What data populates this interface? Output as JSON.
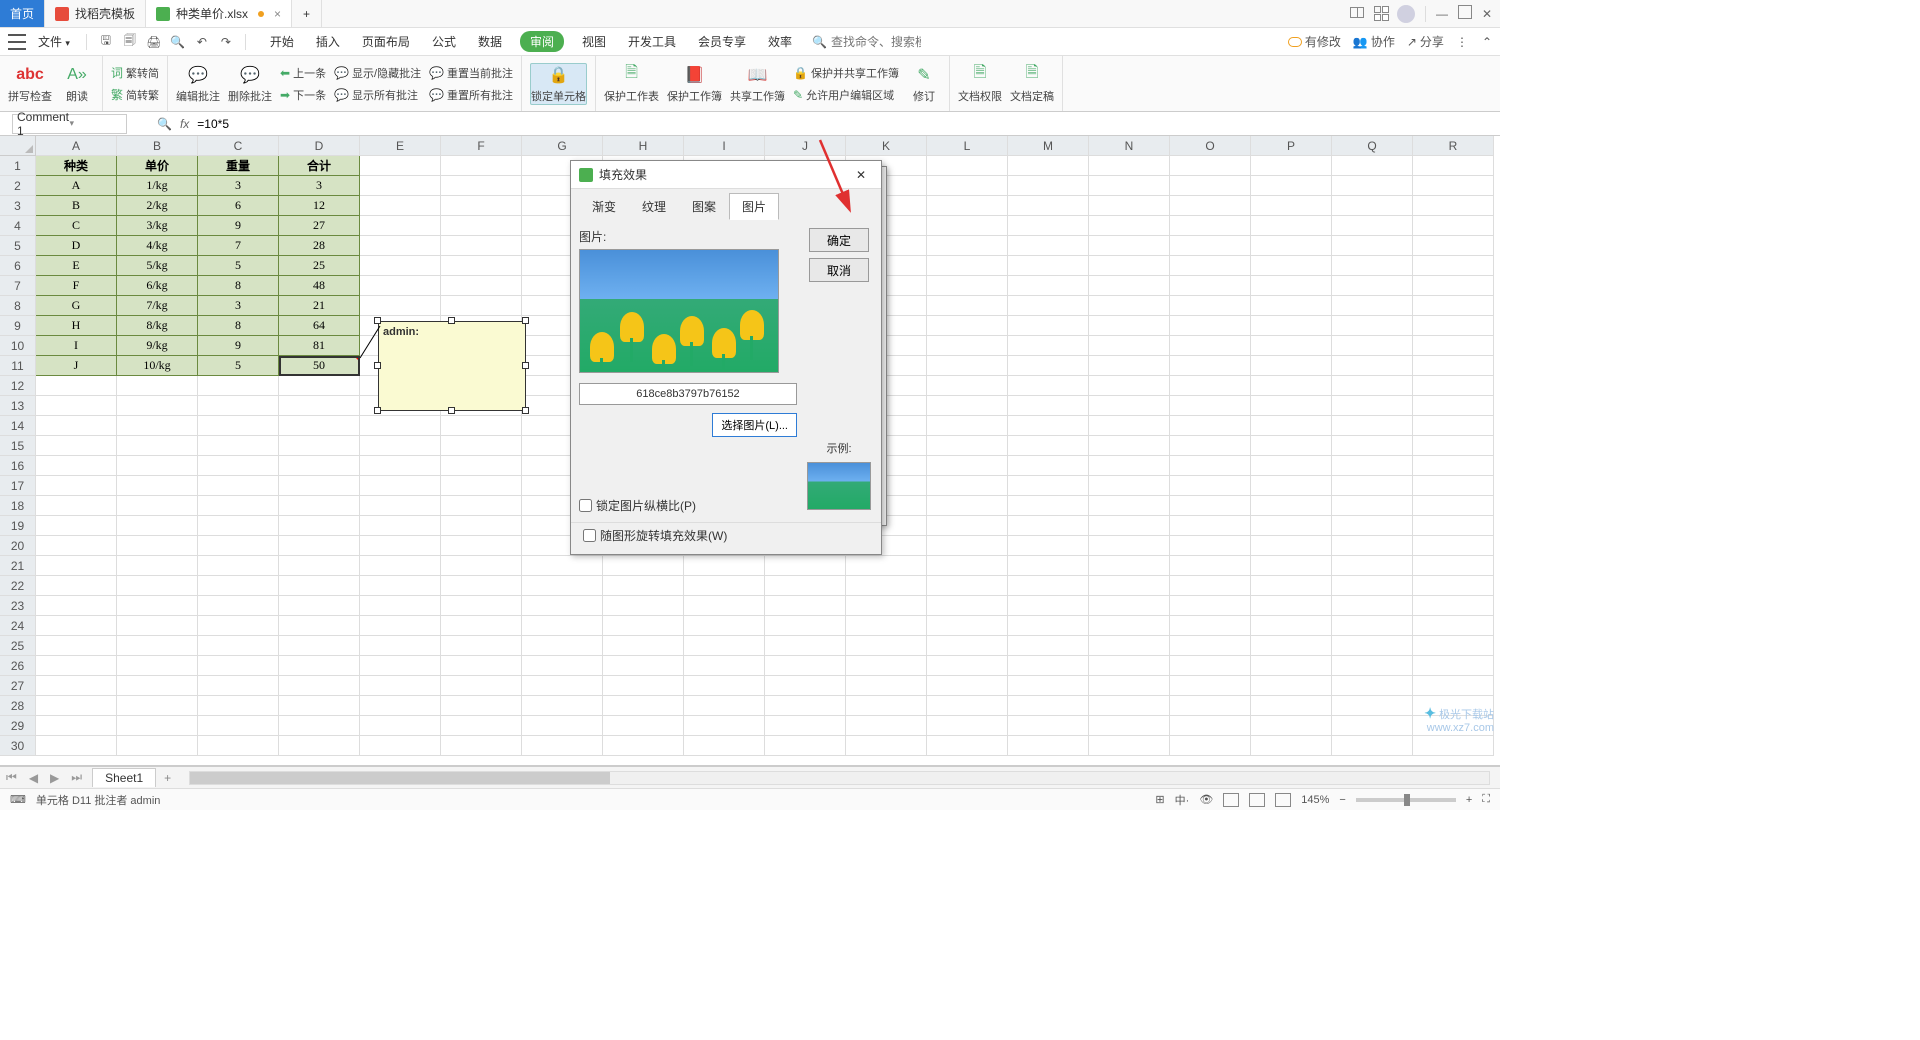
{
  "tabs": {
    "home": "首页",
    "template": "找稻壳模板",
    "file": "种类单价.xlsx"
  },
  "menu": {
    "file": "文件",
    "items": [
      "开始",
      "插入",
      "页面布局",
      "公式",
      "数据",
      "审阅",
      "视图",
      "开发工具",
      "会员专享",
      "效率"
    ],
    "active": "审阅",
    "search_placeholder": "查找命令、搜索模板"
  },
  "ribbon": {
    "g1a": "拼写检查",
    "g1b": "朗读",
    "g2a": "繁转简",
    "g2b": "简转繁",
    "g3a": "编辑批注",
    "g3b": "删除批注",
    "g4a": "上一条",
    "g4b": "下一条",
    "g4c": "显示/隐藏批注",
    "g4d": "显示所有批注",
    "g4e": "重置当前批注",
    "g4f": "重置所有批注",
    "g5": "锁定单元格",
    "g6": "保护工作表",
    "g7": "保护工作簿",
    "g8": "共享工作簿",
    "g9a": "保护并共享工作簿",
    "g9b": "允许用户编辑区域",
    "g10": "修订",
    "g11": "文档权限",
    "g12": "文档定稿"
  },
  "topright": {
    "mod": "有修改",
    "coop": "协作",
    "share": "分享"
  },
  "namebox": "Comment 1",
  "formula": "=10*5",
  "columns": [
    "A",
    "B",
    "C",
    "D",
    "E",
    "F",
    "G",
    "H",
    "I",
    "J",
    "K",
    "L",
    "M",
    "N",
    "O",
    "P",
    "Q",
    "R"
  ],
  "table": {
    "headers": [
      "种类",
      "单价",
      "重量",
      "合计"
    ],
    "rows": [
      [
        "A",
        "1/kg",
        "3",
        "3"
      ],
      [
        "B",
        "2/kg",
        "6",
        "12"
      ],
      [
        "C",
        "3/kg",
        "9",
        "27"
      ],
      [
        "D",
        "4/kg",
        "7",
        "28"
      ],
      [
        "E",
        "5/kg",
        "5",
        "25"
      ],
      [
        "F",
        "6/kg",
        "8",
        "48"
      ],
      [
        "G",
        "7/kg",
        "3",
        "21"
      ],
      [
        "H",
        "8/kg",
        "8",
        "64"
      ],
      [
        "I",
        "9/kg",
        "9",
        "81"
      ],
      [
        "J",
        "10/kg",
        "5",
        "50"
      ]
    ]
  },
  "comment_author": "admin:",
  "dialog": {
    "title": "填充效果",
    "tabs": [
      "渐变",
      "纹理",
      "图案",
      "图片"
    ],
    "active_tab": "图片",
    "pic_label": "图片:",
    "filename": "618ce8b3797b76152",
    "select_btn": "选择图片(L)...",
    "ok": "确定",
    "cancel": "取消",
    "sample": "示例:",
    "lock": "锁定图片纵横比(P)",
    "rotate": "随图形旋转填充效果(W)"
  },
  "sheet": {
    "name": "Sheet1"
  },
  "status": {
    "cell": "单元格 D11 批注者 admin",
    "zoom": "145%"
  },
  "watermark": {
    "a": "极光下载站",
    "b": "www.xz7.com"
  }
}
